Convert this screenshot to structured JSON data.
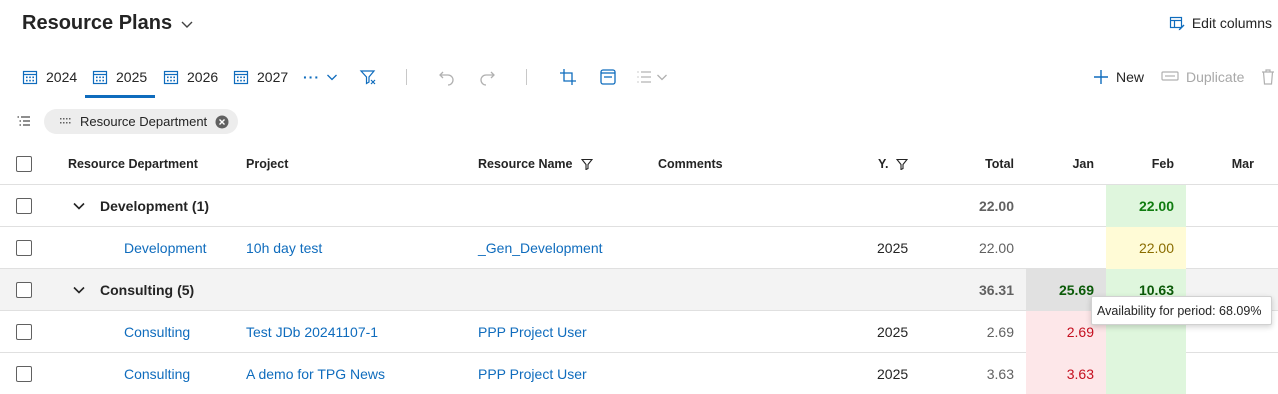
{
  "header": {
    "title": "Resource Plans",
    "edit_columns_label": "Edit columns"
  },
  "toolbar": {
    "years": [
      {
        "label": "2024",
        "active": false
      },
      {
        "label": "2025",
        "active": true
      },
      {
        "label": "2026",
        "active": false
      },
      {
        "label": "2027",
        "active": false
      }
    ],
    "more_label": "···",
    "new_label": "New",
    "duplicate_label": "Duplicate"
  },
  "filter_chip": {
    "label": "Resource Department"
  },
  "grid": {
    "columns": {
      "department": "Resource Department",
      "project": "Project",
      "resource_name": "Resource Name",
      "comments": "Comments",
      "year": "Y.",
      "total": "Total",
      "jan": "Jan",
      "feb": "Feb",
      "mar": "Mar"
    },
    "groups": [
      {
        "name": "Development",
        "count": "(1)",
        "total": "22.00",
        "jan": "",
        "feb": "22.00",
        "rows": [
          {
            "department": "Development",
            "project": "10h day test",
            "resource_name": "_Gen_Development",
            "year": "2025",
            "total": "22.00",
            "jan": "",
            "feb": "22.00"
          }
        ]
      },
      {
        "name": "Consulting",
        "count": "(5)",
        "total": "36.31",
        "jan": "25.69",
        "feb": "10.63",
        "rows": [
          {
            "department": "Consulting",
            "project": "Test JDb 20241107-1",
            "resource_name": "PPP Project User",
            "year": "2025",
            "total": "2.69",
            "jan": "2.69",
            "feb": ""
          },
          {
            "department": "Consulting",
            "project": "A demo for TPG News",
            "resource_name": "PPP Project User",
            "year": "2025",
            "total": "3.63",
            "jan": "3.63",
            "feb": ""
          }
        ]
      }
    ]
  },
  "tooltip": {
    "text": "Availability for period: 68.09%"
  },
  "colors": {
    "accent": "#0f6cbd",
    "green_cell": "#dff6dd",
    "green_text": "#107c10",
    "yellow_cell": "#fffbd6",
    "yellow_text": "#8a6d00",
    "red_cell": "#fde7e9",
    "red_text": "#c50f1f",
    "gray_cell": "#e1e1e1",
    "dark_green_text": "#0b5a08"
  }
}
